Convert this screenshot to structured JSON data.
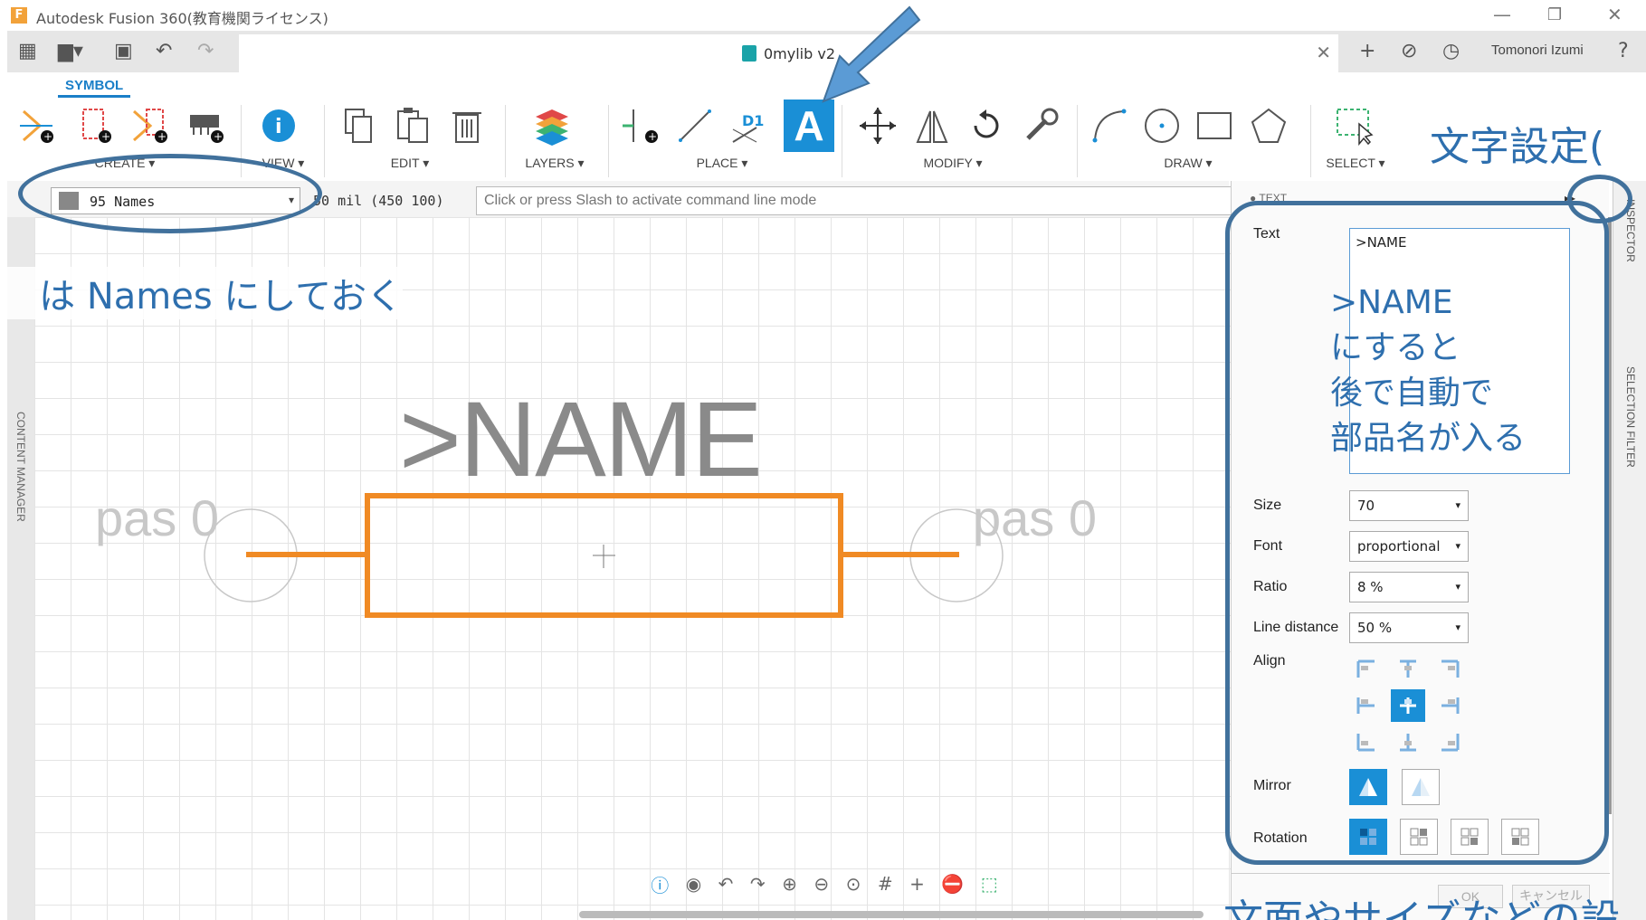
{
  "window": {
    "title": "Autodesk Fusion 360(教育機関ライセンス)",
    "minimize": "—",
    "restore": "❐",
    "close": "✕"
  },
  "tabbar": {
    "doc_title": "0mylib v2",
    "close": "✕",
    "user": "Tomonori Izumi"
  },
  "ribbon": {
    "active_tab": "SYMBOL",
    "groups": [
      {
        "label": "CREATE ▾"
      },
      {
        "label": "VIEW ▾"
      },
      {
        "label": "EDIT ▾"
      },
      {
        "label": "LAYERS ▾"
      },
      {
        "label": "PLACE ▾"
      },
      {
        "label": "MODIFY ▾"
      },
      {
        "label": "DRAW ▾"
      },
      {
        "label": "SELECT ▾"
      }
    ],
    "d1_label": "D1",
    "text_tool_label": "A",
    "accent": "#1a8fd6"
  },
  "command_bar": {
    "layer": "95 Names",
    "layer_arrow": "▾",
    "grid_info": "50 mil (450 100)",
    "placeholder": "Click or press Slash to activate command line mode"
  },
  "sidebar": {
    "content_manager": "CONTENT MANAGER"
  },
  "canvas": {
    "name_text": ">NAME",
    "pin_left": "pas 0",
    "pin_right": "pas 0",
    "body_color": "#f08a24",
    "bottom_tools": [
      "ⓘ",
      "◉",
      "↶",
      "↷",
      "⊕",
      "⊖",
      "⊙",
      "#",
      "+",
      "⛔",
      "⬚"
    ]
  },
  "inspector": {
    "header": "● TEXT",
    "collapse": "▸▸",
    "text_label": "Text",
    "text_value": ">NAME",
    "size_label": "Size",
    "size_value": "70",
    "font_label": "Font",
    "font_value": "proportional",
    "ratio_label": "Ratio",
    "ratio_value": "8 %",
    "line_distance_label": "Line distance",
    "line_distance_value": "50 %",
    "align_label": "Align",
    "mirror_label": "Mirror",
    "rotation_label": "Rotation",
    "ok": "OK",
    "cancel": "キャンセル",
    "dropdown_arrow": "▾"
  },
  "right_strip": {
    "inspector": "INSPECTOR",
    "selection_filter": "SELECTION FILTER"
  },
  "annotations": {
    "top_right": "文字設定(",
    "left": "は Names にしておく",
    "panel_note_1": ">NAME",
    "panel_note_2": "にすると",
    "panel_note_3": "後で自動で",
    "panel_note_4": "部品名が入る",
    "bottom": "文面やサイズなどの設"
  }
}
